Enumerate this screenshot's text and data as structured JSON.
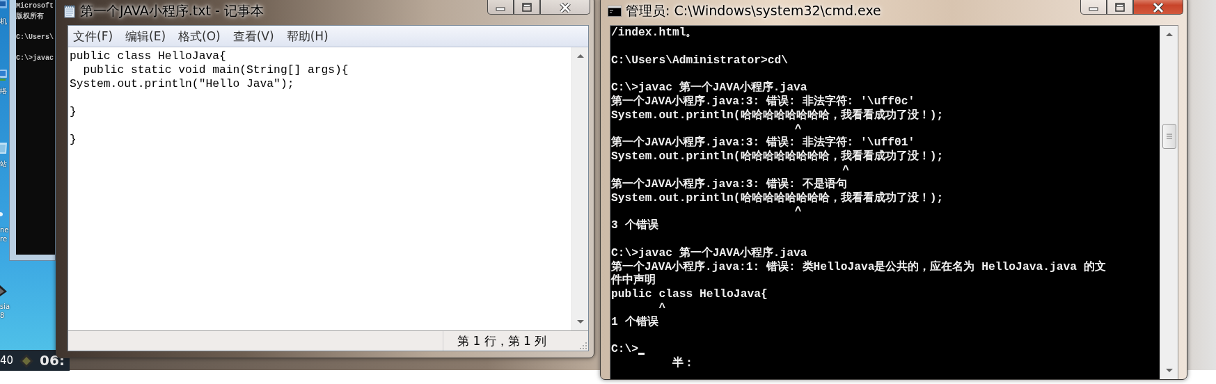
{
  "desktop": {
    "icons": [
      {
        "label": [
          "机"
        ]
      },
      {
        "label": [
          "络"
        ]
      },
      {
        "label": [
          "站"
        ]
      },
      {
        "label": [
          "ne",
          "re"
        ]
      },
      {
        "label": [
          "sia",
          "8"
        ]
      }
    ]
  },
  "background_console": {
    "blocks": [
      [
        "Microsoft",
        "版权所有"
      ],
      [
        "C:\\Users\\"
      ],
      [
        "C:\\>javac"
      ]
    ]
  },
  "taskbar": {
    "clock_fragment": "40",
    "button_fragment": "06:"
  },
  "notepad": {
    "title": "第一个JAVA小程序.txt - 记事本",
    "menu": [
      "文件(F)",
      "编辑(E)",
      "格式(O)",
      "查看(V)",
      "帮助(H)"
    ],
    "text": "public class HelloJava{\n  public static void main(String[] args){\nSystem.out.println(\"Hello Java\");\n\n}\n\n}",
    "status": "第 1 行，第 1 列"
  },
  "cmd": {
    "title": "管理员: C:\\Windows\\system32\\cmd.exe",
    "blocks": [
      [
        "/index.html。"
      ],
      [
        "C:\\Users\\Administrator>cd\\"
      ],
      [
        "C:\\>javac 第一个JAVA小程序.java",
        "第一个JAVA小程序.java:3: 错误: 非法字符: '\\uff0c'",
        "System.out.println(哈哈哈哈哈哈哈哈，我看看成功了没！);",
        "                           ^",
        "第一个JAVA小程序.java:3: 错误: 非法字符: '\\uff01'",
        "System.out.println(哈哈哈哈哈哈哈哈，我看看成功了没！);",
        "                                  ^",
        "第一个JAVA小程序.java:3: 错误: 不是语句",
        "System.out.println(哈哈哈哈哈哈哈哈，我看看成功了没！);",
        "                           ^",
        "3 个错误"
      ],
      [
        "C:\\>javac 第一个JAVA小程序.java",
        "第一个JAVA小程序.java:1: 错误: 类HelloJava是公共的，应在名为 HelloJava.java 的文",
        "件中声明",
        "public class HelloJava{",
        "       ^",
        "1 个错误"
      ],
      [
        {
          "text": "C:\\>",
          "cursor": true
        },
        "         半："
      ]
    ]
  }
}
